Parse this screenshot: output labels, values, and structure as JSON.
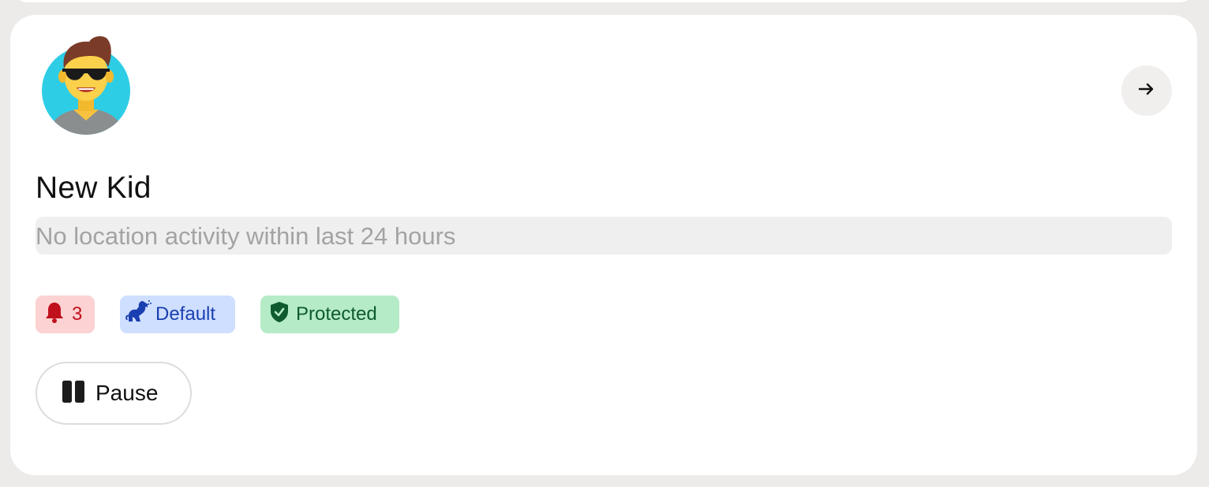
{
  "child": {
    "name": "New Kid",
    "activity_text": "No location activity within last 24 hours",
    "avatar_icon": "boy-with-sunglasses-avatar-icon"
  },
  "badges": {
    "alerts": {
      "label": "3",
      "icon": "bell-icon",
      "bg": "#fdd2d2",
      "color": "#c0101c"
    },
    "profile": {
      "label": "Default",
      "icon": "dog-icon",
      "bg": "#cfdfff",
      "color": "#1a3fb0"
    },
    "status": {
      "label": "Protected",
      "icon": "shield-check-icon",
      "bg": "#b5ebc7",
      "color": "#0f5a2e"
    }
  },
  "actions": {
    "pause_label": "Pause",
    "pause_icon": "pause-icon",
    "open_icon": "arrow-right-icon"
  }
}
